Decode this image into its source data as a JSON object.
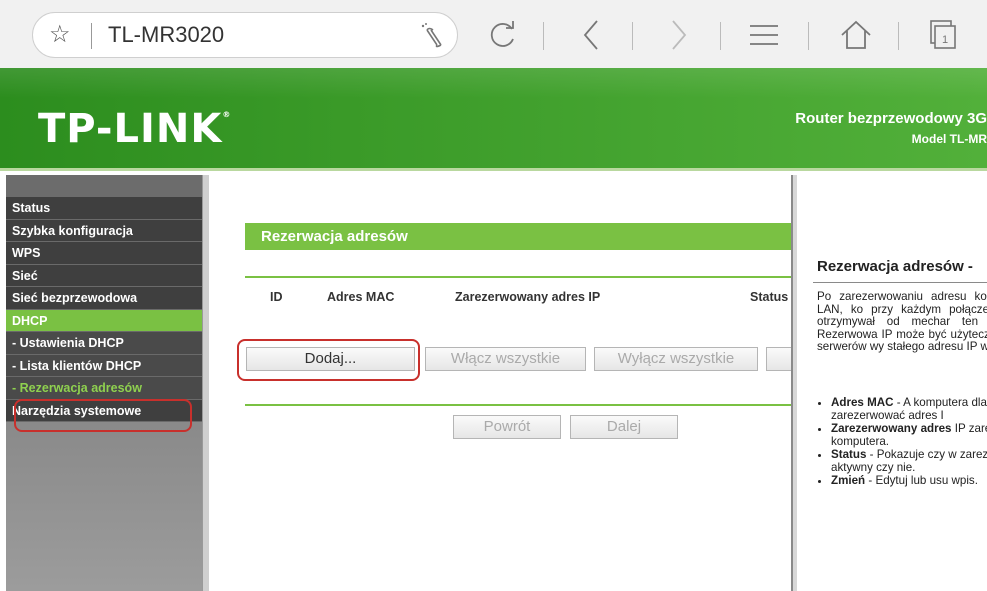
{
  "browser": {
    "url_text": "TL-MR3020"
  },
  "header": {
    "logo": "TP-LINK",
    "router_title": "Router bezprzewodowy 3G",
    "model": "Model TL-MR"
  },
  "sidebar": {
    "items": [
      {
        "label": "Status"
      },
      {
        "label": "Szybka konfiguracja"
      },
      {
        "label": "WPS"
      },
      {
        "label": "Sieć"
      },
      {
        "label": "Sieć bezprzewodowa"
      },
      {
        "label": "DHCP"
      },
      {
        "label": "- Ustawienia DHCP"
      },
      {
        "label": "- Lista klientów DHCP"
      },
      {
        "label": "- Rezerwacja adresów"
      },
      {
        "label": "Narzędzia systemowe"
      }
    ]
  },
  "main": {
    "section_title": "Rezerwacja adresów",
    "columns": [
      "ID",
      "Adres MAC",
      "Zarezerwowany adres IP",
      "Status"
    ],
    "buttons": {
      "add": "Dodaj...",
      "enable_all": "Włącz wszystkie",
      "disable_all": "Wyłącz wszystkie",
      "back": "Powrót",
      "next": "Dalej"
    }
  },
  "help": {
    "title": "Rezerwacja adresów -",
    "paragraph": "Po zarezerwowaniu adresu komputera w sieci LAN, ko przy każdym połączeniu z U będzie otrzymywał od mechar ten sam adres IP. Rezerwowa IP może być użyteczne na przypadku serwerów wy stałego adresu IP w sieci loka",
    "bullets": [
      {
        "term": "Adres MAC",
        "text": " - A komputera dla które zarezerwować adres I"
      },
      {
        "term": "Zarezerwowany adres",
        "text": " IP zarezerwowany komputera."
      },
      {
        "term": "Status",
        "text": " - Pokazuje czy w zarezerwowanych ad aktywny czy nie."
      },
      {
        "term": "Zmień",
        "text": " - Edytuj lub usu wpis."
      }
    ]
  }
}
